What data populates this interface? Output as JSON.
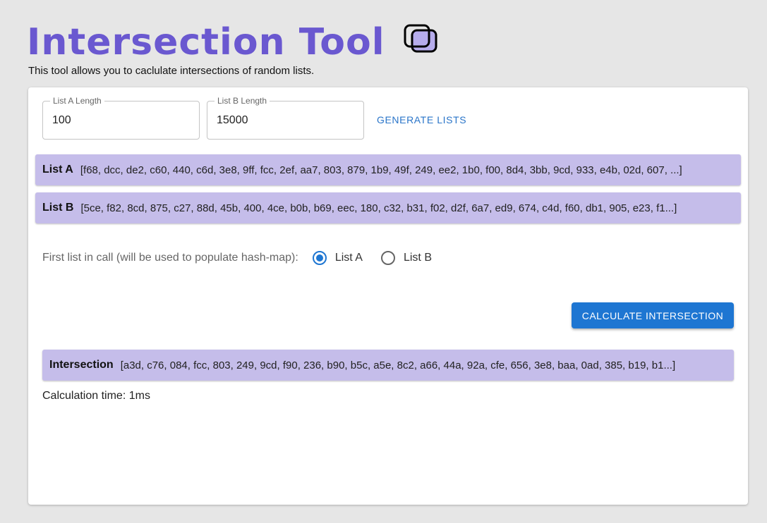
{
  "header": {
    "title": "Intersection Tool",
    "subtitle": "This tool allows you to caclulate intersections of random lists."
  },
  "inputs": {
    "list_a_length": {
      "label": "List A Length",
      "value": "100"
    },
    "list_b_length": {
      "label": "List B Length",
      "value": "15000"
    },
    "generate_label": "GENERATE LISTS"
  },
  "lists": {
    "a": {
      "name": "List A",
      "value": "[f68, dcc, de2, c60, 440, c6d, 3e8, 9ff, fcc, 2ef, aa7, 803, 879, 1b9, 49f, 249, ee2, 1b0, f00, 8d4, 3bb, 9cd, 933, e4b, 02d, 607, ...]"
    },
    "b": {
      "name": "List B",
      "value": "[5ce, f82, 8cd, 875, c27, 88d, 45b, 400, 4ce, b0b, b69, eec, 180, c32, b31, f02, d2f, 6a7, ed9, 674, c4d, f60, db1, 905, e23, f1...]"
    }
  },
  "radio": {
    "label": "First list in call (will be used to populate hash-map):",
    "options": [
      {
        "label": "List A",
        "checked": true
      },
      {
        "label": "List B",
        "checked": false
      }
    ]
  },
  "calculate_label": "CALCULATE INTERSECTION",
  "result": {
    "name": "Intersection",
    "value": "[a3d, c76, 084, fcc, 803, 249, 9cd, f90, 236, b90, b5c, a5e, 8c2, a66, 44a, 92a, cfe, 656, 3e8, baa, 0ad, 385, b19, b1...]",
    "time": "Calculation time: 1ms"
  },
  "colors": {
    "accent": "#6a58d0",
    "primary": "#1e76d2",
    "list_bar": "#c5bdea"
  },
  "icons": {
    "logo": "overlapping-squares-icon"
  }
}
